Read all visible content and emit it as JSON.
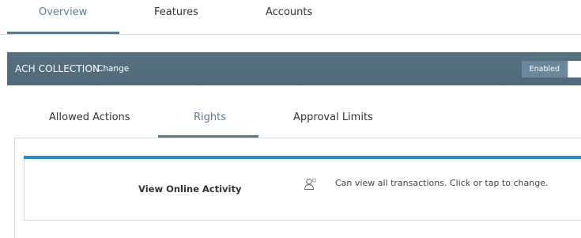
{
  "top_tabs": [
    {
      "label": "Overview",
      "active": true
    },
    {
      "label": "Features",
      "active": false
    },
    {
      "label": "Accounts",
      "active": false
    }
  ],
  "header": {
    "title": "ACH COLLECTION",
    "change_label": "Change",
    "toggle_label": "Enabled",
    "toggle_on": true
  },
  "sub_tabs": [
    {
      "label": "Allowed Actions",
      "active": false
    },
    {
      "label": "Rights",
      "active": true
    },
    {
      "label": "Approval Limits",
      "active": false
    }
  ],
  "rights": [
    {
      "name": "View Online Activity",
      "icon": "user-icon",
      "description": "Can view all transactions. Click or tap to change."
    }
  ],
  "colors": {
    "header_bg": "#54707e",
    "accent_blue": "#1e8fd1",
    "active_tab_text": "#5b7d99",
    "tab_underline": "#5c7a8f"
  }
}
